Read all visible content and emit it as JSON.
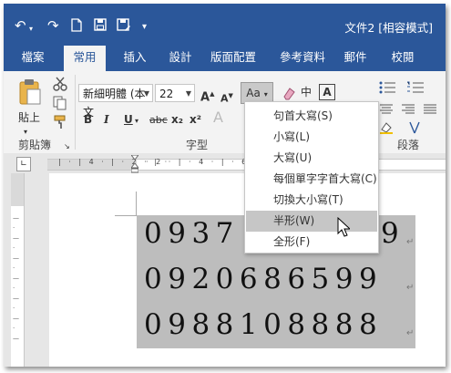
{
  "window": {
    "title": "文件2 [相容模式]"
  },
  "quick_access": [
    "undo-icon",
    "redo-icon",
    "new-doc-icon",
    "save-icon",
    "save-as-icon",
    "customize-icon"
  ],
  "tabs": [
    {
      "label": "檔案",
      "active": false
    },
    {
      "label": "常用",
      "active": true
    },
    {
      "label": "插入",
      "active": false
    },
    {
      "label": "設計",
      "active": false
    },
    {
      "label": "版面配置",
      "active": false
    },
    {
      "label": "參考資料",
      "active": false
    },
    {
      "label": "郵件",
      "active": false
    },
    {
      "label": "校閱",
      "active": false
    }
  ],
  "ribbon": {
    "clipboard": {
      "group_label": "剪貼簿",
      "paste_label": "貼上"
    },
    "font": {
      "group_label": "字型",
      "font_name": "新細明體 (本文",
      "font_size": "22",
      "grow_font": "A",
      "shrink_font": "A",
      "change_case": "Aa",
      "phonetic": "中",
      "char_border": "A",
      "bold": "B",
      "italic": "I",
      "underline": "U",
      "strikethrough": "abc",
      "subscript": "x₂",
      "superscript": "x²"
    },
    "paragraph": {
      "group_label": "段落"
    }
  },
  "change_case_menu": {
    "items": [
      {
        "label": "句首大寫(S)",
        "highlighted": false
      },
      {
        "label": "小寫(L)",
        "highlighted": false
      },
      {
        "label": "大寫(U)",
        "highlighted": false
      },
      {
        "label": "每個單字字首大寫(C)",
        "highlighted": false
      },
      {
        "label": "切換大小寫(T)",
        "highlighted": false
      },
      {
        "label": "半形(W)",
        "highlighted": true
      },
      {
        "label": "全形(F)",
        "highlighted": false
      }
    ]
  },
  "document": {
    "lines": [
      "0937",
      "0920686599",
      "0988108888"
    ],
    "line1_tail": "9",
    "paragraph_mark": "↵"
  },
  "colors": {
    "title_bar": "#2b579a",
    "ribbon": "#f3f3f3",
    "selection": "#bdbdbd",
    "menu_highlight": "#c6c6c6"
  }
}
